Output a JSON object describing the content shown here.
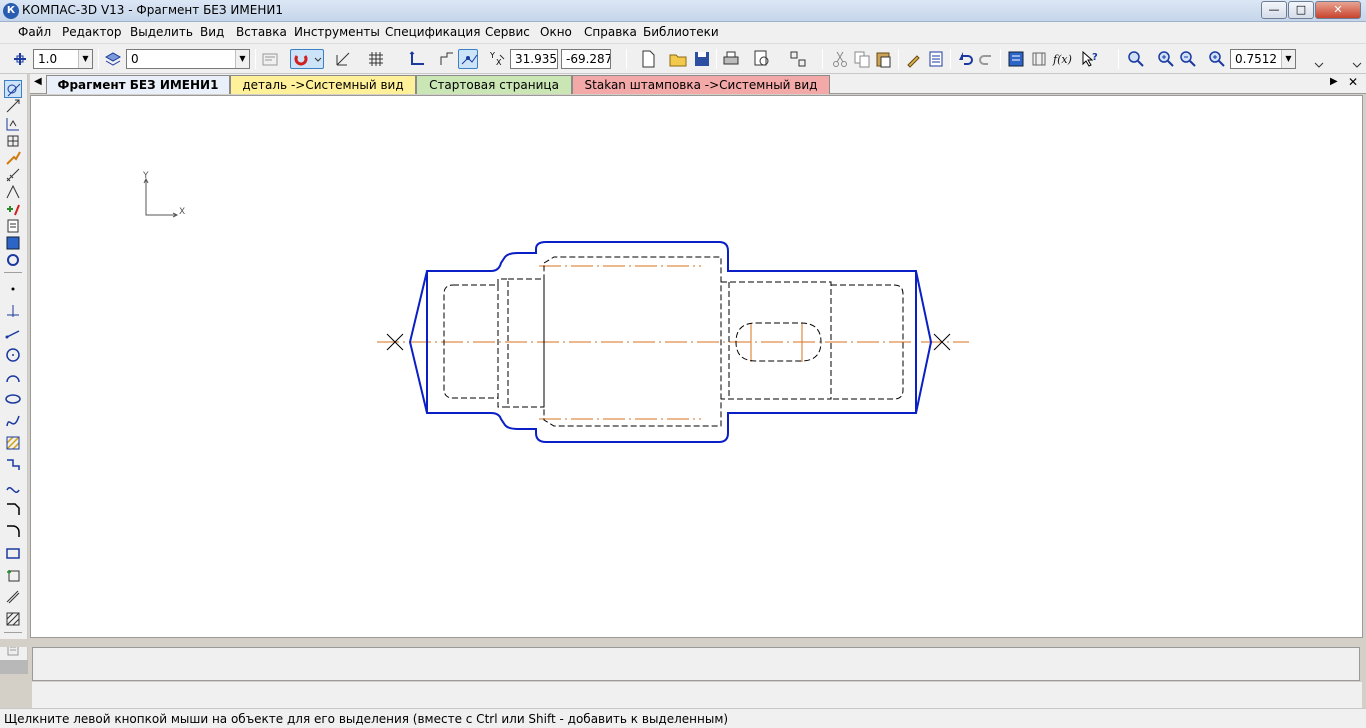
{
  "window": {
    "title": "КОМПАС-3D V13 - Фрагмент БЕЗ ИМЕНИ1",
    "app_icon": "К",
    "controls": {
      "minimize": "—",
      "maximize": "□",
      "close": "✕"
    }
  },
  "menu": {
    "items": [
      {
        "label": "Файл"
      },
      {
        "label": "Редактор"
      },
      {
        "label": "Выделить"
      },
      {
        "label": "Вид"
      },
      {
        "label": "Вставка"
      },
      {
        "label": "Инструменты"
      },
      {
        "label": "Спецификация"
      },
      {
        "label": "Сервис"
      },
      {
        "label": "Окно"
      },
      {
        "label": "Справка"
      },
      {
        "label": "Библиотеки"
      }
    ]
  },
  "toolbar": {
    "line_style_value": "1.0",
    "layer_value": "0",
    "coord_x": "31.9356",
    "coord_y": "-69.287",
    "zoom_value": "0.7512"
  },
  "tabs": [
    {
      "label": "Фрагмент БЕЗ ИМЕНИ1",
      "color": "#eaf0fa",
      "active": true
    },
    {
      "label": "деталь ->Системный вид",
      "color": "#fff199"
    },
    {
      "label": "Стартовая страница",
      "color": "#cbe6b5"
    },
    {
      "label": "Stakan штамповка ->Системный вид",
      "color": "#f4a9a9"
    }
  ],
  "canvas": {
    "axis_y": "Y",
    "axis_x": "X",
    "colors": {
      "outline": "#0b1fc7",
      "hidden": "#000000",
      "center": "#d8731f"
    }
  },
  "status": {
    "message": "Щелкните левой кнопкой мыши на объекте для его выделения (вместе с Ctrl или Shift - добавить к выделенным)"
  }
}
